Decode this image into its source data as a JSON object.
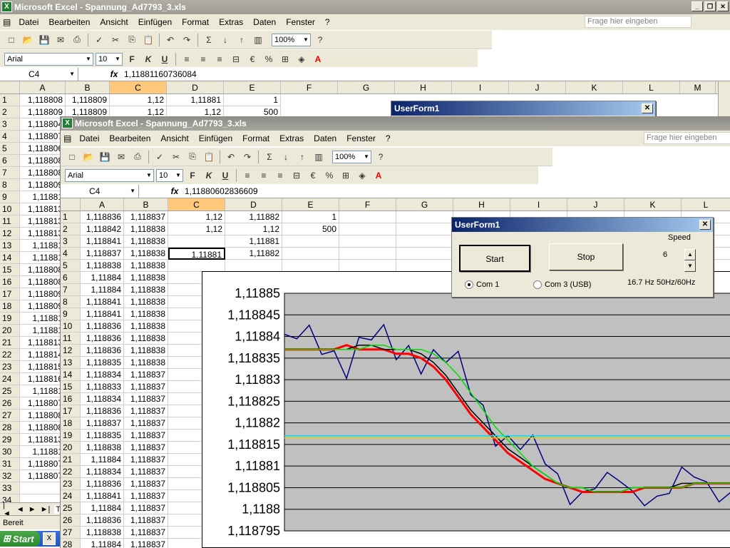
{
  "back_window": {
    "title": "Microsoft Excel - Spannung_Ad7793_3.xls",
    "menu": [
      "Datei",
      "Bearbeiten",
      "Ansicht",
      "Einfügen",
      "Format",
      "Extras",
      "Daten",
      "Fenster",
      "?"
    ],
    "help_placeholder": "Frage hier eingeben",
    "zoom": "100%",
    "font": "Arial",
    "font_size": "10",
    "name_box": "C4",
    "formula": "1,11881160736084",
    "columns": [
      "A",
      "B",
      "C",
      "D",
      "E",
      "F",
      "G",
      "H",
      "I",
      "J",
      "K",
      "L",
      "M"
    ],
    "rows": [
      [
        "1",
        "1,118808",
        "1,118809",
        "1,12",
        "1,11881",
        "1"
      ],
      [
        "2",
        "1,118809",
        "1,118809",
        "1,12",
        "1,12",
        "500"
      ]
    ],
    "row_numbers": [
      "3",
      "4",
      "5",
      "6",
      "7",
      "8",
      "9",
      "10",
      "11",
      "12",
      "13",
      "14",
      "15",
      "16",
      "17",
      "18",
      "19",
      "20",
      "21",
      "22",
      "23",
      "24",
      "25",
      "26",
      "27",
      "28",
      "29",
      "30",
      "31",
      "32",
      "33",
      "34"
    ],
    "col_a_partial": [
      "1,118804",
      "1,118807",
      "1,118806",
      "1,118808",
      "1,118808",
      "1,118809",
      "1,11881",
      "1,118813",
      "1,118813",
      "1,118813",
      "1,11881",
      "1,11881",
      "1,118808",
      "1,118808",
      "1,118809",
      "1,118809",
      "1,11881",
      "1,11881",
      "1,118813",
      "1,118814",
      "1,118815",
      "1,118816",
      "1,11881",
      "1,118807",
      "1,118808",
      "1,118808",
      "1,118813",
      "1,11881",
      "1,118807",
      "1,118807"
    ],
    "sheet_tab": "Ta",
    "status": "Bereit",
    "userform_title": "UserForm1"
  },
  "front_window": {
    "title": "Microsoft Excel - Spannung_Ad7793_3.xls",
    "menu": [
      "Datei",
      "Bearbeiten",
      "Ansicht",
      "Einfügen",
      "Format",
      "Extras",
      "Daten",
      "Fenster",
      "?"
    ],
    "help_placeholder": "Frage hier eingeben",
    "zoom": "100%",
    "font": "Arial",
    "font_size": "10",
    "name_box": "C4",
    "formula": "1,11880602836609",
    "columns": [
      "A",
      "B",
      "C",
      "D",
      "E",
      "F",
      "G",
      "H",
      "I",
      "J",
      "K",
      "L"
    ],
    "rows": [
      [
        "1",
        "1,118836",
        "1,118837",
        "1,12",
        "1,11882",
        "1"
      ],
      [
        "2",
        "1,118842",
        "1,118838",
        "1,12",
        "1,12",
        "500"
      ],
      [
        "3",
        "1,118841",
        "1,118838",
        "",
        "1,11881",
        ""
      ],
      [
        "4",
        "1,118837",
        "1,118838",
        "1,11881",
        "1,11882",
        ""
      ],
      [
        "5",
        "1,118838",
        "1,118838",
        "",
        "",
        ""
      ],
      [
        "6",
        "1,11884",
        "1,118838",
        "",
        "",
        ""
      ],
      [
        "7",
        "1,11884",
        "1,118838",
        "",
        "",
        ""
      ],
      [
        "8",
        "1,118841",
        "1,118838",
        "",
        "",
        ""
      ],
      [
        "9",
        "1,118841",
        "1,118838",
        "",
        "",
        ""
      ],
      [
        "10",
        "1,118836",
        "1,118838",
        "",
        "",
        ""
      ],
      [
        "11",
        "1,118836",
        "1,118838",
        "",
        "",
        ""
      ],
      [
        "12",
        "1,118836",
        "1,118838",
        "",
        "",
        ""
      ],
      [
        "13",
        "1,118835",
        "1,118838",
        "",
        "",
        ""
      ],
      [
        "14",
        "1,118834",
        "1,118837",
        "",
        "",
        ""
      ],
      [
        "15",
        "1,118833",
        "1,118837",
        "",
        "",
        ""
      ],
      [
        "16",
        "1,118834",
        "1,118837",
        "",
        "",
        ""
      ],
      [
        "17",
        "1,118836",
        "1,118837",
        "",
        "",
        ""
      ],
      [
        "18",
        "1,118837",
        "1,118837",
        "",
        "",
        ""
      ],
      [
        "19",
        "1,118835",
        "1,118837",
        "",
        "",
        ""
      ],
      [
        "20",
        "1,118838",
        "1,118837",
        "",
        "",
        ""
      ],
      [
        "21",
        "1,11884",
        "1,118837",
        "",
        "",
        ""
      ],
      [
        "22",
        "1,118834",
        "1,118837",
        "",
        "",
        ""
      ],
      [
        "23",
        "1,118836",
        "1,118837",
        "",
        "",
        ""
      ],
      [
        "24",
        "1,118841",
        "1,118837",
        "",
        "",
        ""
      ],
      [
        "25",
        "1,11884",
        "1,118837",
        "",
        "",
        ""
      ],
      [
        "26",
        "1,118836",
        "1,118837",
        "",
        "",
        ""
      ],
      [
        "27",
        "1,118838",
        "1,118837",
        "",
        "",
        ""
      ],
      [
        "28",
        "1,11884",
        "1,118837",
        "",
        "",
        ""
      ]
    ]
  },
  "userform": {
    "title": "UserForm1",
    "start_label": "Start",
    "stop_label": "Stop",
    "speed_label": "Speed",
    "speed_value": "6",
    "com1_label": "Com 1",
    "com3_label": "Com 3 (USB)",
    "freq_label": "16.7 Hz 50Hz/60Hz"
  },
  "taskbar": {
    "start_label": "Start"
  },
  "chart_data": {
    "type": "line",
    "title": "",
    "xlabel": "",
    "ylabel": "",
    "ylim": [
      1.118795,
      1.11885
    ],
    "y_ticks": [
      "1,11885",
      "1,118845",
      "1,11884",
      "1,118835",
      "1,11883",
      "1,118825",
      "1,11882",
      "1,118815",
      "1,11881",
      "1,118805",
      "1,1188",
      "1,118795"
    ],
    "x_range": [
      0,
      500
    ],
    "series": [
      {
        "color": "#000080",
        "values": [
          1.118838,
          1.118839,
          1.118837,
          1.118838,
          1.118837,
          1.118836,
          1.118838,
          1.118839,
          1.118837,
          1.118836,
          1.118838,
          1.118837,
          1.118836,
          1.118834,
          1.118831,
          1.118827,
          1.118824,
          1.11882,
          1.118817,
          1.118814,
          1.118812,
          1.11881,
          1.118808,
          1.118806,
          1.118805,
          1.118805,
          1.118804,
          1.118805,
          1.118804,
          1.118805,
          1.118805,
          1.118804,
          1.118806,
          1.118805,
          1.118806,
          1.118805,
          1.118807
        ]
      },
      {
        "color": "#ff0000",
        "values": [
          1.118837,
          1.118837,
          1.118837,
          1.118837,
          1.118837,
          1.118838,
          1.118837,
          1.118837,
          1.118837,
          1.118836,
          1.118836,
          1.118835,
          1.118833,
          1.11883,
          1.118826,
          1.118822,
          1.118819,
          1.118816,
          1.118813,
          1.118811,
          1.118809,
          1.118807,
          1.118806,
          1.118805,
          1.118804,
          1.118804,
          1.118804,
          1.118804,
          1.118804,
          1.118805,
          1.118805,
          1.118805,
          1.118805,
          1.118806,
          1.118806,
          1.118806,
          1.118806
        ]
      },
      {
        "color": "#000000",
        "values": [
          1.118837,
          1.118837,
          1.118837,
          1.118837,
          1.118837,
          1.118837,
          1.118838,
          1.118838,
          1.118837,
          1.118837,
          1.118837,
          1.118836,
          1.118834,
          1.118831,
          1.118827,
          1.118823,
          1.11882,
          1.118817,
          1.118814,
          1.118812,
          1.11881,
          1.118808,
          1.118806,
          1.118805,
          1.118805,
          1.118804,
          1.118804,
          1.118804,
          1.118805,
          1.118805,
          1.118805,
          1.118805,
          1.118806,
          1.118806,
          1.118806,
          1.118806,
          1.118806
        ]
      },
      {
        "color": "#00e000",
        "values": [
          1.118837,
          1.118837,
          1.118837,
          1.118837,
          1.118837,
          1.118837,
          1.118837,
          1.118838,
          1.118838,
          1.118837,
          1.118837,
          1.118837,
          1.118836,
          1.118834,
          1.118831,
          1.118827,
          1.118823,
          1.118819,
          1.118816,
          1.118813,
          1.11881,
          1.118808,
          1.118806,
          1.118805,
          1.118805,
          1.118804,
          1.118804,
          1.118804,
          1.118805,
          1.118805,
          1.118805,
          1.118805,
          1.118805,
          1.118806,
          1.118806,
          1.118806,
          1.118806
        ]
      },
      {
        "color": "#00e0ff",
        "values": [
          1.118817,
          1.118817,
          1.118817,
          1.118817,
          1.118817,
          1.118817,
          1.118817,
          1.118817,
          1.118817,
          1.118817,
          1.118817,
          1.118817,
          1.118817,
          1.118817,
          1.118817,
          1.118817,
          1.118817,
          1.118817,
          1.118817,
          1.118817,
          1.118817,
          1.118817,
          1.118817,
          1.118817,
          1.118817,
          1.118817,
          1.118817,
          1.118817,
          1.118817,
          1.118817,
          1.118817,
          1.118817,
          1.118817,
          1.118817,
          1.118817,
          1.118817,
          1.118817
        ]
      },
      {
        "color": "#e0d000",
        "values": [
          1.1188165,
          1.1188165,
          1.1188165,
          1.1188165,
          1.1188165,
          1.1188165,
          1.1188165,
          1.1188165,
          1.1188165,
          1.1188165,
          1.1188165,
          1.1188165,
          1.1188165,
          1.1188165,
          1.1188165,
          1.1188165,
          1.1188165,
          1.1188165,
          1.1188165,
          1.1188165,
          1.1188165,
          1.1188165,
          1.1188165,
          1.1188165,
          1.1188165,
          1.1188165,
          1.1188165,
          1.1188165,
          1.1188165,
          1.1188165,
          1.1188165,
          1.1188165,
          1.1188165,
          1.1188165,
          1.1188165,
          1.1188165,
          1.1188165
        ]
      }
    ],
    "grid": true,
    "plot_bg": "#c0c0c0"
  }
}
